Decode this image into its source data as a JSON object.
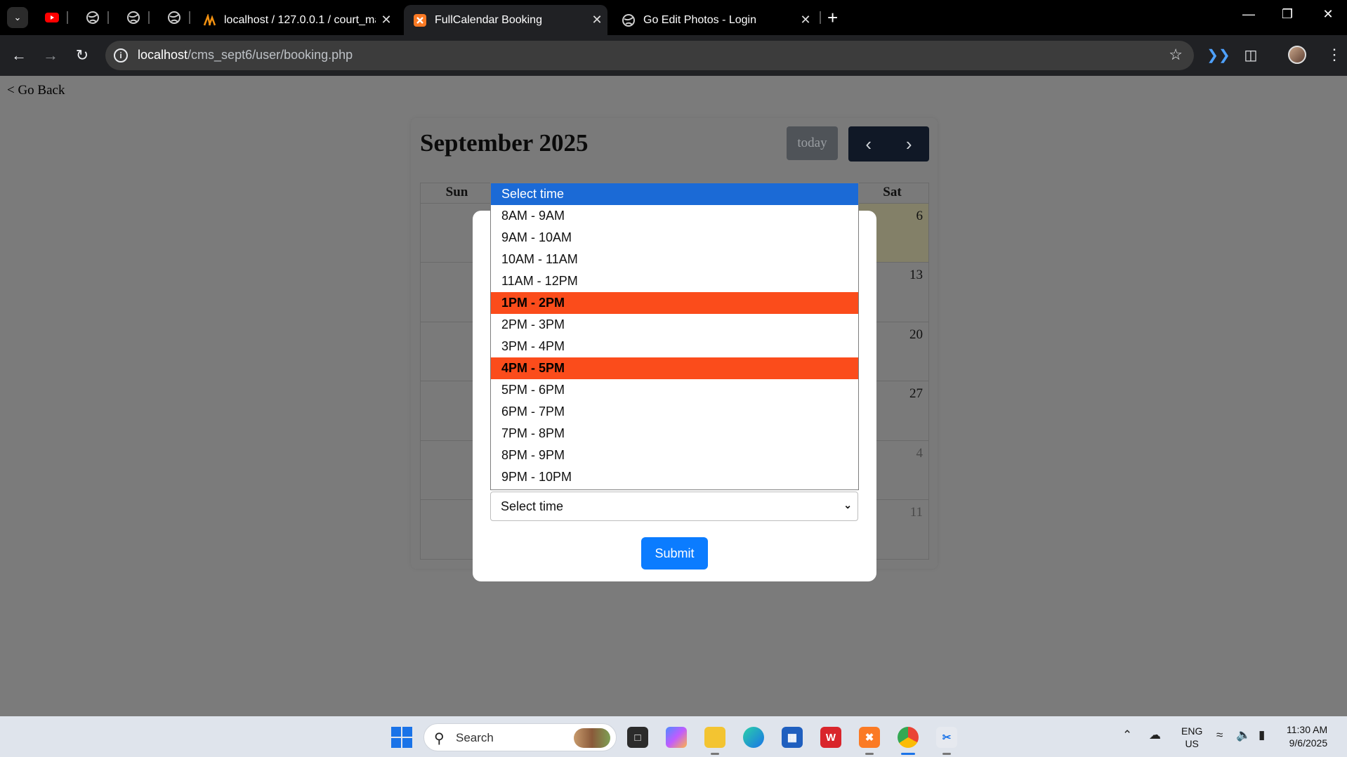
{
  "browser": {
    "tabs": [
      {
        "title": "localhost / 127.0.0.1 / court_ma",
        "icon": "phpmyadmin-icon",
        "active": false
      },
      {
        "title": "FullCalendar Booking",
        "icon": "xampp-icon",
        "active": true
      },
      {
        "title": "Go Edit Photos - Login",
        "icon": "globe-icon",
        "active": false
      }
    ],
    "pinned_icons": [
      "youtube-icon",
      "globe-icon",
      "globe-icon",
      "globe-icon"
    ],
    "url_host": "localhost",
    "url_path": "/cms_sept6/user/booking.php"
  },
  "page": {
    "go_back": "< Go Back"
  },
  "calendar": {
    "title": "September 2025",
    "today_label": "today",
    "day_headers": [
      "Sun",
      "Sat"
    ],
    "visible_dates": [
      {
        "label": "6",
        "current_month": true
      },
      {
        "label": "13",
        "current_month": true
      },
      {
        "label": "20",
        "current_month": true
      },
      {
        "label": "27",
        "current_month": true
      },
      {
        "label": "4",
        "current_month": false
      },
      {
        "label": "11",
        "current_month": false
      }
    ]
  },
  "modal": {
    "time_select_value": "Select time",
    "submit_label": "Submit",
    "options": [
      {
        "label": "Select time",
        "state": "selected"
      },
      {
        "label": "8AM - 9AM",
        "state": "available"
      },
      {
        "label": "9AM - 10AM",
        "state": "available"
      },
      {
        "label": "10AM - 11AM",
        "state": "available"
      },
      {
        "label": "11AM - 12PM",
        "state": "available"
      },
      {
        "label": "1PM - 2PM",
        "state": "booked"
      },
      {
        "label": "2PM - 3PM",
        "state": "available"
      },
      {
        "label": "3PM - 4PM",
        "state": "available"
      },
      {
        "label": "4PM - 5PM",
        "state": "booked"
      },
      {
        "label": "5PM - 6PM",
        "state": "available"
      },
      {
        "label": "6PM - 7PM",
        "state": "available"
      },
      {
        "label": "7PM - 8PM",
        "state": "available"
      },
      {
        "label": "8PM - 9PM",
        "state": "available"
      },
      {
        "label": "9PM - 10PM",
        "state": "available"
      }
    ]
  },
  "colors": {
    "booked": "#fb4c1b",
    "selected": "#1b6ad6",
    "submit": "#0b7cff"
  },
  "taskbar": {
    "search_label": "Search",
    "lang_line1": "ENG",
    "lang_line2": "US",
    "time": "11:30 AM",
    "date": "9/6/2025"
  }
}
